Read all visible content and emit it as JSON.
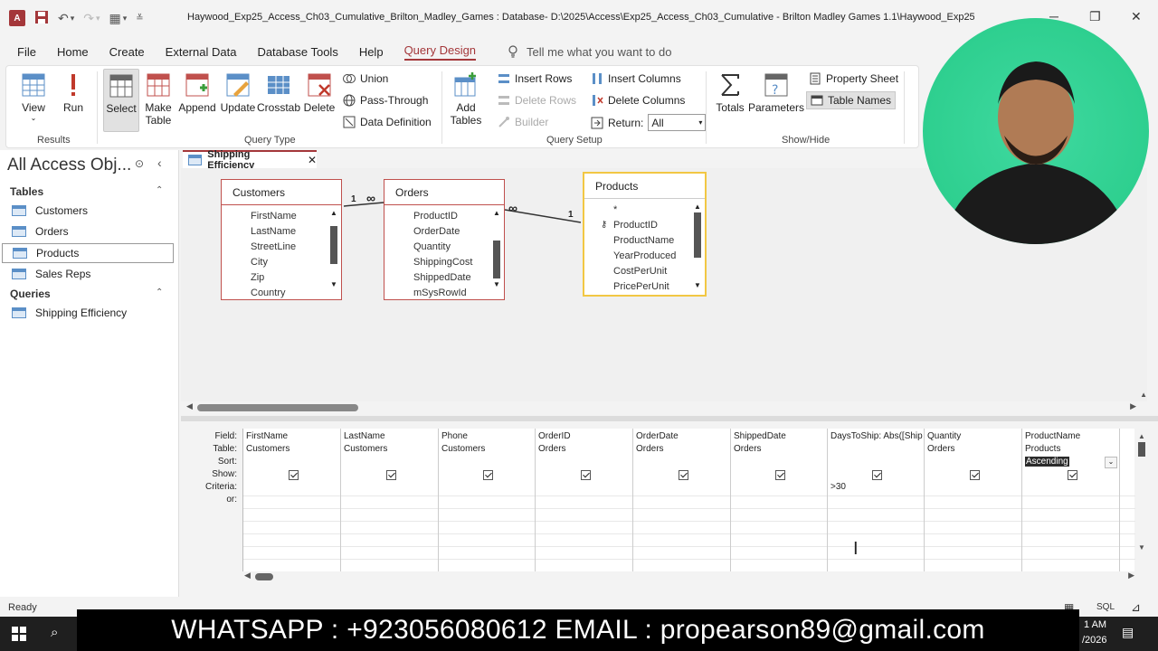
{
  "window": {
    "app_icon_label": "A",
    "title": "Haywood_Exp25_Access_Ch03_Cumulative_Brilton_Madley_Games : Database- D:\\2025\\Access\\Exp25_Access_Ch03_Cumulative - Brilton Madley Games 1.1\\Haywood_Exp25_..."
  },
  "menu": {
    "items": [
      "File",
      "Home",
      "Create",
      "External Data",
      "Database Tools",
      "Help",
      "Query Design"
    ],
    "active": "Query Design",
    "tellme": "Tell me what you want to do"
  },
  "ribbon": {
    "results": {
      "label": "Results",
      "view": "View",
      "run": "Run"
    },
    "query_type": {
      "label": "Query Type",
      "select": "Select",
      "make_table_1": "Make",
      "make_table_2": "Table",
      "append": "Append",
      "update": "Update",
      "crosstab": "Crosstab",
      "delete": "Delete",
      "union": "Union",
      "pass_through": "Pass-Through",
      "data_definition": "Data Definition"
    },
    "query_setup": {
      "label": "Query Setup",
      "add_tables_1": "Add",
      "add_tables_2": "Tables",
      "insert_rows": "Insert Rows",
      "delete_rows": "Delete Rows",
      "builder": "Builder",
      "insert_columns": "Insert Columns",
      "delete_columns": "Delete Columns",
      "return_label": "Return:",
      "return_value": "All"
    },
    "show_hide": {
      "label": "Show/Hide",
      "totals": "Totals",
      "parameters": "Parameters",
      "property_sheet": "Property Sheet",
      "table_names": "Table Names"
    }
  },
  "nav": {
    "title": "All Access Obj...",
    "tables_header": "Tables",
    "tables": [
      "Customers",
      "Orders",
      "Products",
      "Sales Reps"
    ],
    "selected": "Products",
    "queries_header": "Queries",
    "queries": [
      "Shipping Efficiency"
    ]
  },
  "document": {
    "tab": "Shipping Efficiency",
    "tables": {
      "customers": {
        "name": "Customers",
        "fields": [
          "FirstName",
          "LastName",
          "StreetLine",
          "City",
          "Zip",
          "Country"
        ]
      },
      "orders": {
        "name": "Orders",
        "fields": [
          "ProductID",
          "OrderDate",
          "Quantity",
          "ShippingCost",
          "ShippedDate",
          "mSysRowId"
        ]
      },
      "products": {
        "name": "Products",
        "fields": [
          "*",
          "ProductID",
          "ProductName",
          "YearProduced",
          "CostPerUnit",
          "PricePerUnit"
        ]
      }
    },
    "join_labels": {
      "one": "1",
      "many": "∞"
    }
  },
  "grid": {
    "row_labels": [
      "Field:",
      "Table:",
      "Sort:",
      "Show:",
      "Criteria:",
      "or:"
    ],
    "columns": [
      {
        "field": "FirstName",
        "table": "Customers",
        "sort": "",
        "criteria": ""
      },
      {
        "field": "LastName",
        "table": "Customers",
        "sort": "",
        "criteria": ""
      },
      {
        "field": "Phone",
        "table": "Customers",
        "sort": "",
        "criteria": ""
      },
      {
        "field": "OrderID",
        "table": "Orders",
        "sort": "",
        "criteria": ""
      },
      {
        "field": "OrderDate",
        "table": "Orders",
        "sort": "",
        "criteria": ""
      },
      {
        "field": "ShippedDate",
        "table": "Orders",
        "sort": "",
        "criteria": ""
      },
      {
        "field": "DaysToShip: Abs([Ship",
        "table": "",
        "sort": "",
        "criteria": ">30"
      },
      {
        "field": "Quantity",
        "table": "Orders",
        "sort": "",
        "criteria": ""
      },
      {
        "field": "ProductName",
        "table": "Products",
        "sort": "Ascending",
        "criteria": ""
      }
    ]
  },
  "status": {
    "ready": "Ready",
    "sql": "SQL",
    "time": "1 AM",
    "date": "/2026"
  },
  "banner": {
    "text": "WHATSAPP : +923056080612 EMAIL : propearson89@gmail.com"
  },
  "colors": {
    "access_red": "#a4373a",
    "selected_table_border": "#f2c744",
    "webcam_bg": "#2ecf8f"
  }
}
